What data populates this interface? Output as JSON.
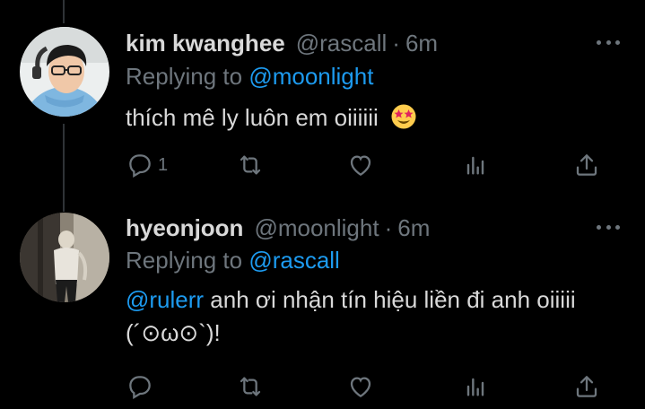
{
  "tweets": [
    {
      "name": "kim kwanghee",
      "handle": "@rascall",
      "separator": "·",
      "time": "6m",
      "replying_prefix": "Replying to",
      "replying_to": "@moonlight",
      "text": "thích mê ly luôn em oiiiiii",
      "emoji": "star-struck-emoji",
      "actions": {
        "reply_count": "1",
        "retweet_count": "",
        "like_count": ""
      }
    },
    {
      "name": "hyeonjoon",
      "handle": "@moonlight",
      "separator": "·",
      "time": "6m",
      "replying_prefix": "Replying to",
      "replying_to": "@rascall",
      "mention": "@rulerr",
      "text": " anh ơi nhận tín hiệu liền đi anh oiiiii (´⊙ω⊙`)!",
      "actions": {
        "reply_count": "",
        "retweet_count": "",
        "like_count": ""
      }
    }
  ],
  "colors": {
    "background": "#000000",
    "text": "#d9d9d9",
    "muted": "#6e767d",
    "link": "#1d9bf0"
  }
}
